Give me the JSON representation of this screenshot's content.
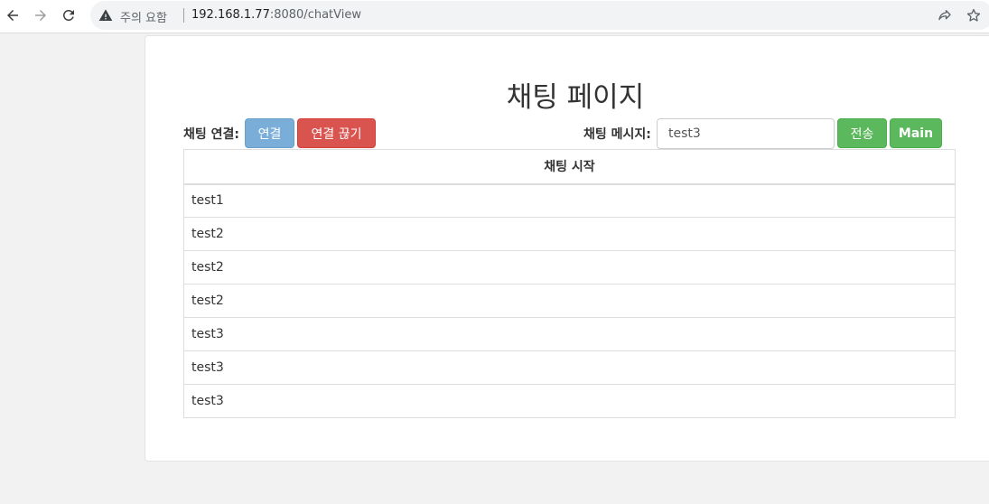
{
  "browser": {
    "security_warning": "주의 요함",
    "url_host": "192.168.1.77",
    "url_rest": ":8080/chatView"
  },
  "page": {
    "title": "채팅 페이지",
    "connect_label": "채팅 연결:",
    "connect_button": "연결",
    "disconnect_button": "연결 끊기",
    "message_label": "채팅 메시지:",
    "message_value": "test3",
    "send_button": "전송",
    "main_button": "Main",
    "table_header": "채팅 시작",
    "messages": [
      "test1",
      "test2",
      "test2",
      "test2",
      "test3",
      "test3",
      "test3"
    ]
  },
  "colors": {
    "connect": "#7aaed8",
    "disconnect": "#d9534f",
    "send": "#5cb85c",
    "main": "#5cb85c"
  }
}
